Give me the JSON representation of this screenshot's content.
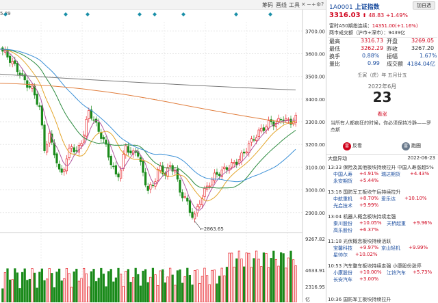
{
  "toolbar": {
    "items": [
      "筹码",
      "画线",
      "工具"
    ],
    "icons": [
      "close-icon",
      "zoom-out-icon",
      "zoom-in-icon",
      "gear-icon",
      "help-icon"
    ]
  },
  "chart": {
    "top_left_label": "5.89",
    "y_ticks": [
      "3700.00",
      "3600.00",
      "3500.00",
      "3400.00",
      "3300.00",
      "3200.00",
      "3100.00",
      "3000.00",
      "2900.00"
    ],
    "low_label": "2863.65",
    "vol_ticks": [
      "9267.82",
      "4633.91",
      "2316.95"
    ],
    "vol_unit": "亿"
  },
  "chart_data": {
    "type": "candlestick",
    "series": [
      {
        "name": "price",
        "values": []
      },
      {
        "name": "volume",
        "values": []
      }
    ],
    "ylim": [
      2830,
      3740
    ],
    "low_marker": 2863.65
  },
  "quote": {
    "code": "1A0001",
    "name": "上证指数",
    "add_button": "加自选",
    "price": "3316.03",
    "change": "48.83",
    "change_pct": "+1.49%",
    "a50_label": "富时A50期指连续：",
    "a50_value": "14351.00(+1.16%)",
    "turnover_label": "两市成交额（沪市+深市）：",
    "turnover_value": "9439亿"
  },
  "stats": [
    {
      "k1": "最高",
      "v1": "3316.73",
      "k2": "开盘",
      "v2": "3269.05"
    },
    {
      "k1": "最低",
      "v1": "3262.29",
      "k2": "昨收",
      "v2": "3267.20"
    },
    {
      "k1": "换手",
      "v1": "0.88%",
      "k2": "振幅",
      "v2": "1.67%"
    },
    {
      "k1": "量比",
      "v1": "0.99",
      "k2": "成交额",
      "v2": "4184.04亿"
    }
  ],
  "calendar": {
    "lunar": "壬寅（虎）年 五月廿五",
    "year_month": "2022年6月",
    "day": "23",
    "tag": "看涨",
    "quote": "当所有人都疯狂的时候，你必须保持冷静——罗杰斯",
    "bull": "反看",
    "bear": "跑圈",
    "bull_icon": "富",
    "bear_icon": "富"
  },
  "events": {
    "title": "大盘异动",
    "date": "2022-06-23",
    "items": [
      {
        "head": "13:33 保险及其他板块持续拉升 中国人寿涨超5%",
        "stocks": [
          [
            "中国人寿",
            "+4.91%",
            "瑞达期货",
            "+4.43%"
          ],
          [
            "永安期货",
            "+5.44%",
            "",
            ""
          ]
        ]
      },
      {
        "head": "13:18 国防军工板块午后持续拉升",
        "stocks": [
          [
            "中航重机",
            "+8.70%",
            "爱乐达",
            "+10.10%"
          ],
          [
            "光启技术",
            "+9.99%",
            "",
            ""
          ]
        ]
      },
      {
        "head": "13:04 机器人概念板块持续走强",
        "stocks": [
          [
            "秦川股份",
            "+10.05%",
            "天桥起重",
            "+9.96%"
          ],
          [
            "高乐股份",
            "+6.37%",
            "",
            ""
          ]
        ]
      },
      {
        "head": "11:18 光伏概念板块持续活跃",
        "stocks": [
          [
            "宝馨科技",
            "+9.97%",
            "京山轻机",
            "+9.99%"
          ],
          [
            "星帅尔",
            "+10.02%",
            "",
            ""
          ]
        ]
      },
      {
        "head": "10:53 汽车整车板块持续走强 小康股份涨停",
        "stocks": [
          [
            "小康股份",
            "+10.00%",
            "江铃汽车",
            "+5.73%"
          ],
          [
            "长安汽车",
            "+3.00%",
            "",
            ""
          ]
        ]
      },
      {
        "head": "10:36 国防军工板块持续拉升",
        "stocks": []
      }
    ]
  }
}
